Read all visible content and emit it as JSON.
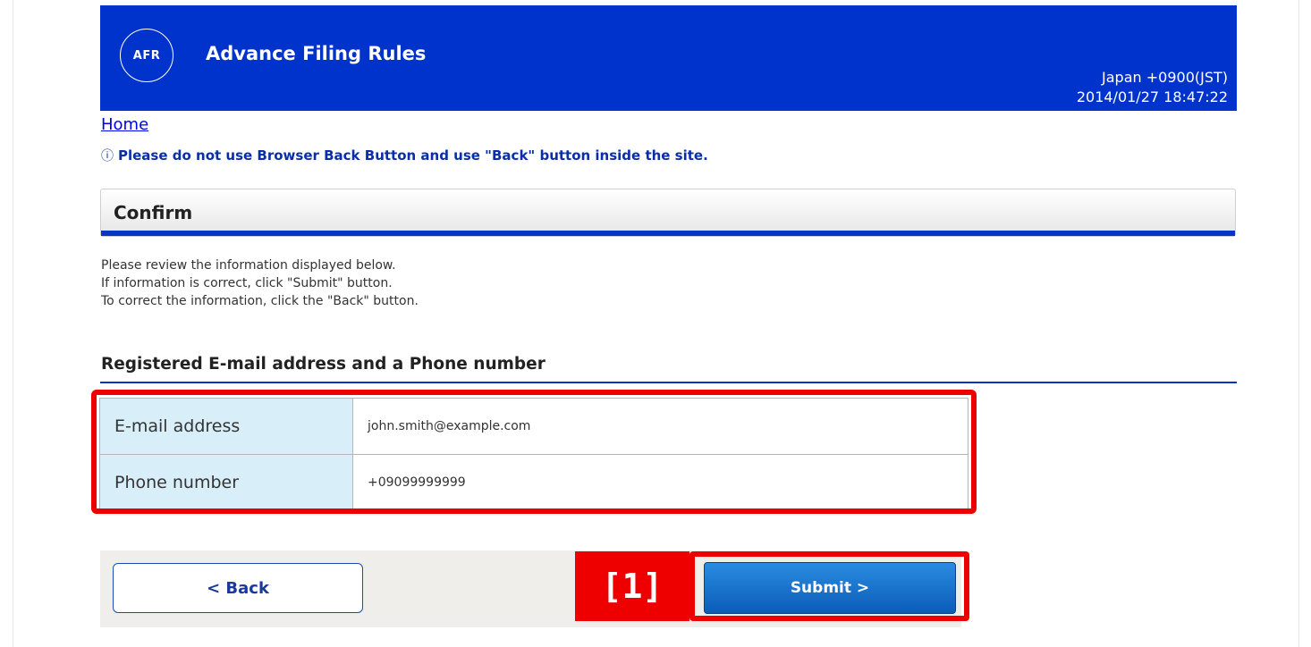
{
  "header": {
    "logo_text": "AFR",
    "title": "Advance Filing Rules",
    "timezone": "Japan +0900(JST)",
    "datetime": "2014/01/27 18:47:22"
  },
  "nav": {
    "home_link": "Home"
  },
  "notice": {
    "icon": "info-icon",
    "text": "Please do not use Browser Back Button and use \"Back\" button inside the site."
  },
  "confirm": {
    "title": "Confirm"
  },
  "instructions": [
    "Please review the information displayed below.",
    "If information is correct, click \"Submit\" button.",
    "To correct the information, click the \"Back\" button."
  ],
  "section": {
    "title": "Registered E-mail address and a Phone number",
    "rows": [
      {
        "label": "E-mail address",
        "value": "john.smith@example.com"
      },
      {
        "label": "Phone number",
        "value": "+09099999999"
      }
    ]
  },
  "buttons": {
    "back_label": "< Back",
    "submit_label": "Submit >",
    "callout_label": "[1]"
  },
  "colors": {
    "header_bg": "#0033cc",
    "accent_blue": "#0a33c8",
    "highlight_red": "#ee0000",
    "label_cell_bg": "#d8eef9"
  }
}
